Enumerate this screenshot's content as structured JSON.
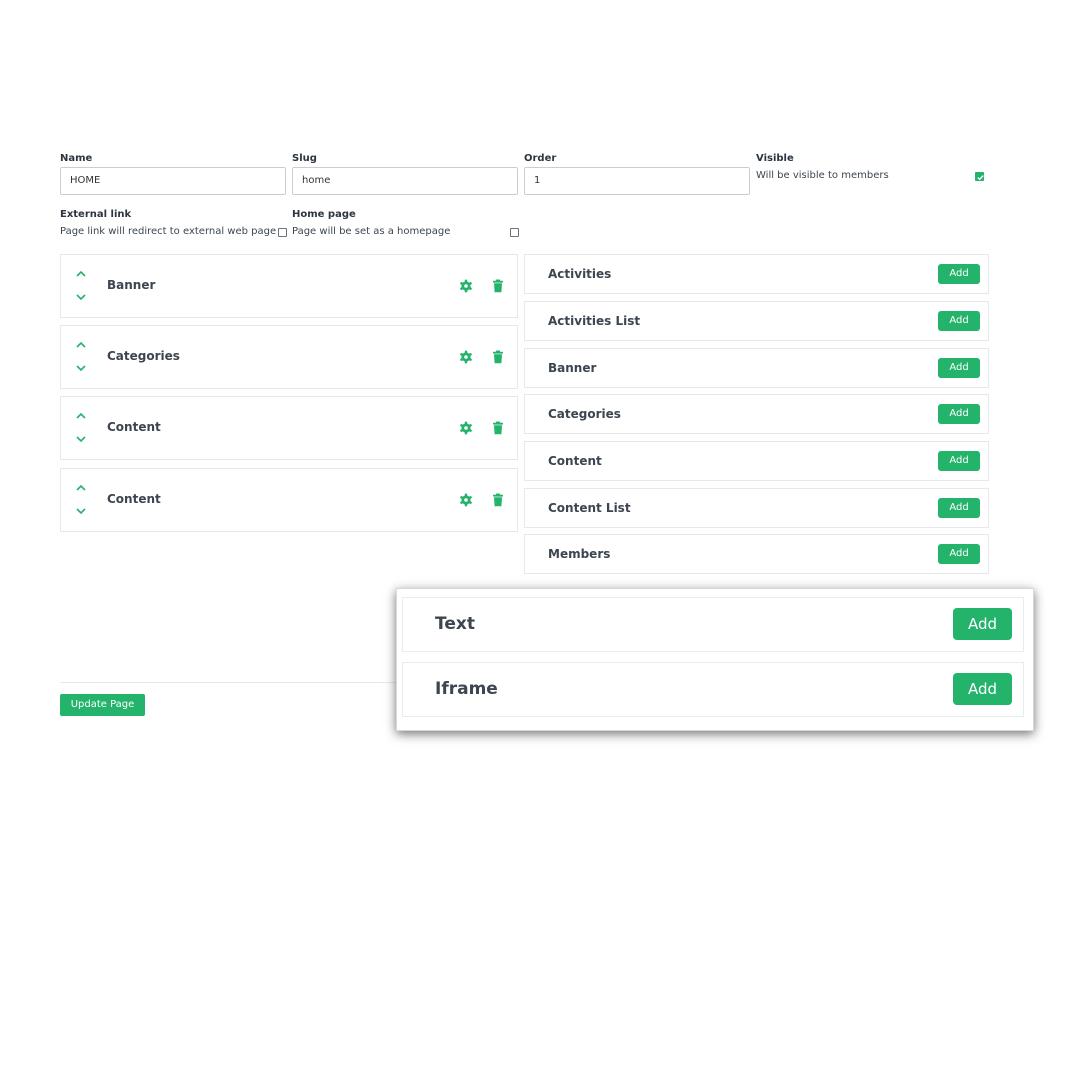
{
  "form": {
    "name": {
      "label": "Name",
      "value": "HOME"
    },
    "slug": {
      "label": "Slug",
      "value": "home"
    },
    "order": {
      "label": "Order",
      "value": "1"
    },
    "visible": {
      "label": "Visible",
      "help": "Will be visible to members",
      "checked": true
    },
    "external_link": {
      "label": "External link",
      "help": "Page link will redirect to external web page",
      "checked": false
    },
    "home_page": {
      "label": "Home page",
      "help": "Page will be set as a homepage",
      "checked": false
    }
  },
  "blocks": [
    {
      "name": "Banner"
    },
    {
      "name": "Categories"
    },
    {
      "name": "Content"
    },
    {
      "name": "Content"
    }
  ],
  "components": {
    "add_label": "Add",
    "items": [
      {
        "name": "Activities"
      },
      {
        "name": "Activities List"
      },
      {
        "name": "Banner"
      },
      {
        "name": "Categories"
      },
      {
        "name": "Content"
      },
      {
        "name": "Content List"
      },
      {
        "name": "Members"
      }
    ]
  },
  "zoomed": {
    "items": [
      {
        "name": "Text",
        "add_label": "Add"
      },
      {
        "name": "Iframe",
        "add_label": "Add"
      }
    ]
  },
  "update_button": "Update Page",
  "colors": {
    "accent": "#24b36b",
    "text": "#3c4550",
    "border": "#e6e9ec"
  }
}
